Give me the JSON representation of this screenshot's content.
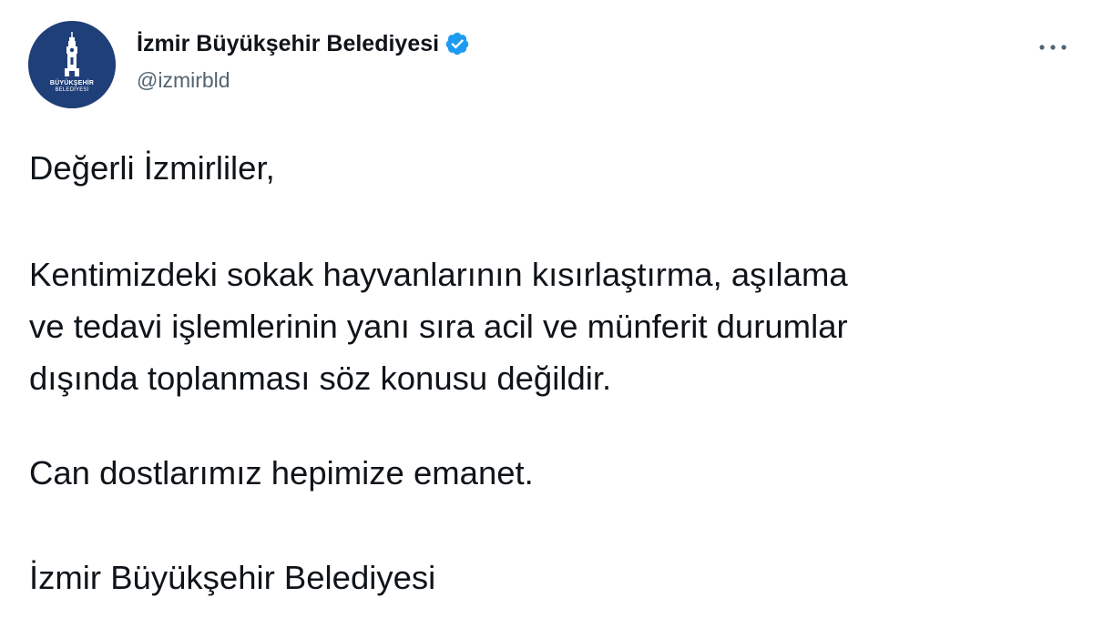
{
  "tweet": {
    "author": {
      "display_name": "İzmir Büyükşehir Belediyesi",
      "handle": "@izmirbld",
      "verified": true,
      "verified_icon": "verified-badge-icon",
      "avatar_icon": "izmir-municipality-logo",
      "avatar_text_line1": "BÜYÜKŞEHİR",
      "avatar_text_line2": "BELEDİYESİ",
      "avatar_color": "#1f3f78"
    },
    "more_icon": "more-horizontal-icon",
    "text": {
      "greeting": "Değerli İzmirliler,",
      "main": "Kentimizdeki sokak hayvanlarının kısırlaştırma, aşılama\nve tedavi işlemlerinin yanı sıra acil ve münferit durumlar\ndışında toplanması söz konusu değildir.",
      "closing": "Can dostlarımız hepimize emanet.",
      "signature": "İzmir Büyükşehir Belediyesi"
    },
    "colors": {
      "text": "#0f1419",
      "secondary": "#536471",
      "verified_blue": "#1d9bf0"
    }
  }
}
